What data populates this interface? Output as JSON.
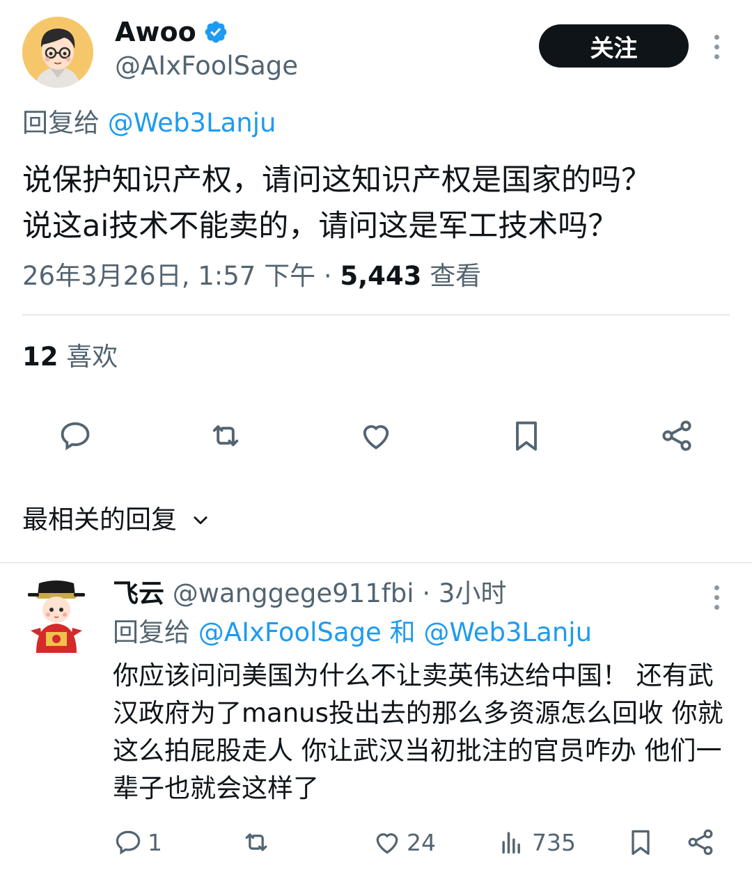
{
  "tweet": {
    "author": {
      "display_name": "Awoo",
      "handle": "@AIxFoolSage",
      "verified": true
    },
    "follow_label": "关注",
    "reply_to_prefix": "回复给",
    "reply_to_handle": "@Web3Lanju",
    "text_line1": "说保护知识产权，请问这知识产权是国家的吗？",
    "text_line2": "说这ai技术不能卖的，请问这是军工技术吗？",
    "timestamp": "26年3月26日, 1:57 下午",
    "separator": " · ",
    "views_count": "5,443",
    "views_label": "查看",
    "likes_count": "12",
    "likes_label": "喜欢",
    "actions": [
      "comment-icon",
      "retweet-icon",
      "heart-icon",
      "bookmark-icon",
      "share-icon"
    ]
  },
  "sort": {
    "label": "最相关的回复"
  },
  "reply": {
    "display_name": "飞云",
    "handle": "@wanggege911fbi",
    "separator": " · ",
    "time": "3小时",
    "reply_to_prefix": "回复给",
    "reply_to_handle1": "@AIxFoolSage",
    "reply_to_and": "和",
    "reply_to_handle2": "@Web3Lanju",
    "text": "你应该问问美国为什么不让卖英伟达给中国！ 还有武汉政府为了manus投出去的那么多资源怎么回收 你就这么拍屁股走人 你让武汉当初批注的官员咋办 他们一辈子也就会这样了",
    "comments": "1",
    "likes": "24",
    "views": "735"
  },
  "colors": {
    "accent": "#1d9bf0",
    "muted": "#536471",
    "text": "#0f1419"
  }
}
